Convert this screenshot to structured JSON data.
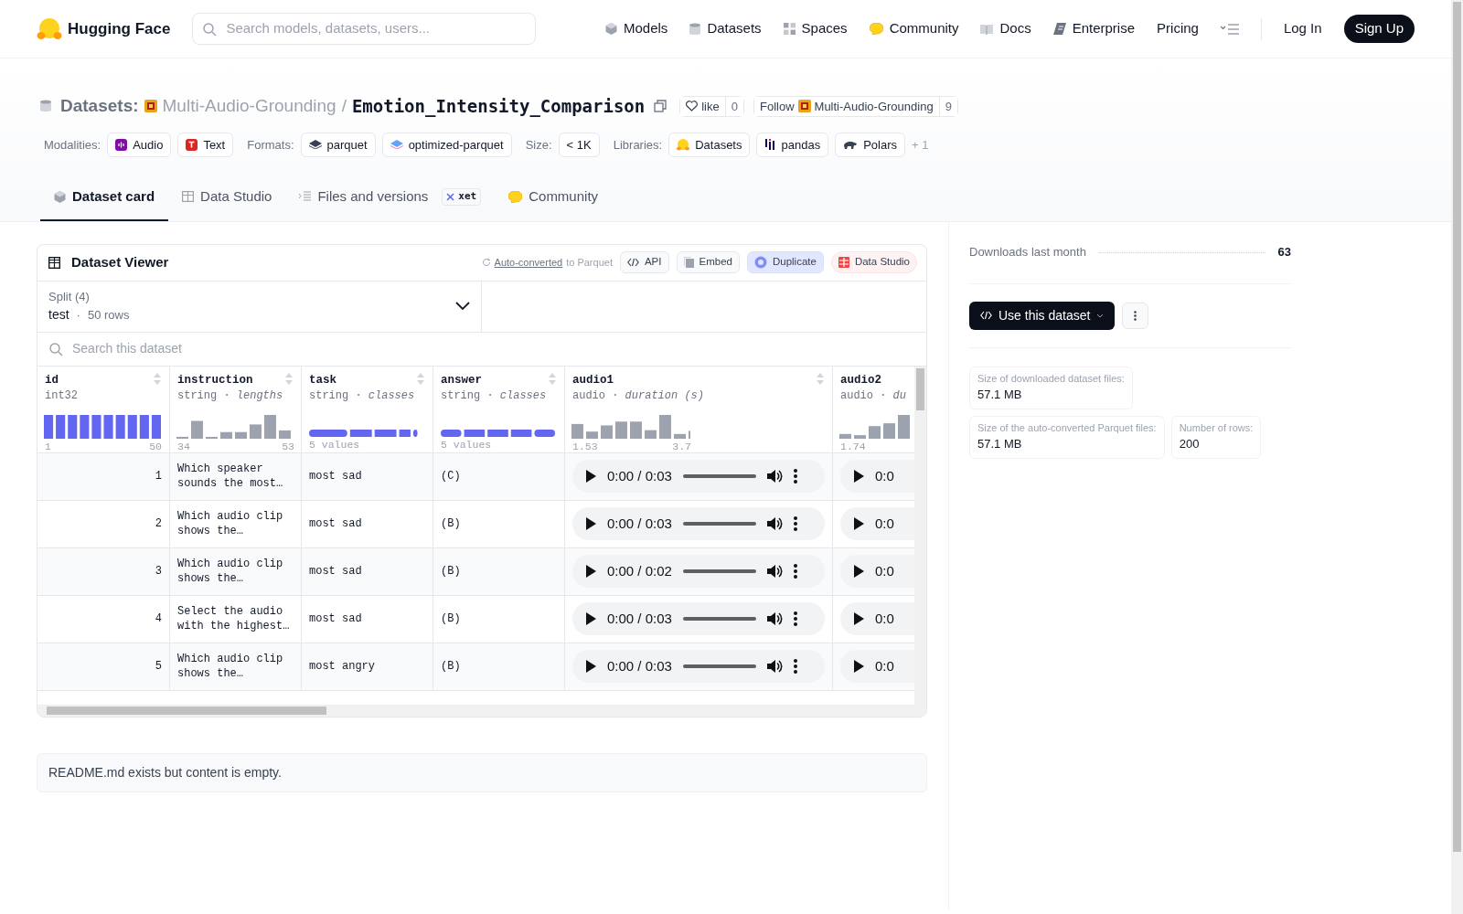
{
  "header": {
    "brand": "Hugging Face",
    "search": {
      "placeholder": "Search models, datasets, users..."
    },
    "nav": [
      {
        "label": "Models"
      },
      {
        "label": "Datasets"
      },
      {
        "label": "Spaces"
      },
      {
        "label": "Community"
      },
      {
        "label": "Docs"
      },
      {
        "label": "Enterprise"
      },
      {
        "label": "Pricing"
      }
    ],
    "login": "Log In",
    "signup": "Sign Up"
  },
  "title": {
    "section": "Datasets:",
    "owner": "Multi-Audio-Grounding",
    "separator": "/",
    "name": "Emotion_Intensity_Comparison",
    "like": "like",
    "like_count": "0",
    "follow": "Follow",
    "follow_org": "Multi-Audio-Grounding",
    "follow_count": "9"
  },
  "tag_groups": [
    {
      "label": "Modalities:",
      "items": [
        "Audio",
        "Text"
      ]
    },
    {
      "label": "Formats:",
      "items": [
        "parquet",
        "optimized-parquet"
      ]
    },
    {
      "label": "Size:",
      "items": [
        "< 1K"
      ]
    },
    {
      "label": "Libraries:",
      "items": [
        "Datasets",
        "pandas",
        "Polars"
      ],
      "more": "+ 1"
    }
  ],
  "tabs": [
    {
      "label": "Dataset card",
      "selected": true
    },
    {
      "label": "Data Studio",
      "selected": false
    },
    {
      "label": "Files and versions",
      "badge": "xet",
      "selected": false
    },
    {
      "label": "Community",
      "selected": false
    }
  ],
  "viewer": {
    "title": "Dataset Viewer",
    "converted_link": "Auto-converted",
    "converted_text": "to Parquet",
    "actions": [
      "API",
      "Embed",
      "Duplicate",
      "Data Studio"
    ],
    "split": {
      "label": "Split (4)",
      "value": "test",
      "separator": "·",
      "rows": "50 rows"
    },
    "search": {
      "placeholder": "Search this dataset"
    },
    "columns": [
      {
        "name": "id",
        "type": "int32",
        "kind": "histogram",
        "min": "1",
        "max": "50"
      },
      {
        "name": "instruction",
        "type": "string · *lengths*",
        "kind": "histogram",
        "min": "34",
        "max": "53"
      },
      {
        "name": "task",
        "type": "string · *classes*",
        "kind": "classes",
        "summary": "5 values"
      },
      {
        "name": "answer",
        "type": "string · *classes*",
        "kind": "classes",
        "summary": "5 values"
      },
      {
        "name": "audio1",
        "type": "audio · *duration (s)*",
        "kind": "histogram",
        "min": "1.53",
        "max": "3.7"
      },
      {
        "name": "audio2",
        "type": "audio · *du*",
        "kind": "histogram",
        "min": "1.74"
      }
    ],
    "rows": [
      {
        "id": "1",
        "instruction": "Which speaker sounds the most…",
        "task": "most sad",
        "answer": "(C)",
        "audio1": "0:00 / 0:03",
        "audio2": "0:0"
      },
      {
        "id": "2",
        "instruction": "Which audio clip shows the…",
        "task": "most sad",
        "answer": "(B)",
        "audio1": "0:00 / 0:03",
        "audio2": "0:0"
      },
      {
        "id": "3",
        "instruction": "Which audio clip shows the…",
        "task": "most sad",
        "answer": "(B)",
        "audio1": "0:00 / 0:02",
        "audio2": "0:0"
      },
      {
        "id": "4",
        "instruction": "Select the audio with the highest…",
        "task": "most sad",
        "answer": "(B)",
        "audio1": "0:00 / 0:03",
        "audio2": "0:0"
      },
      {
        "id": "5",
        "instruction": "Which audio clip shows the…",
        "task": "most angry",
        "answer": "(B)",
        "audio1": "0:00 / 0:03",
        "audio2": "0:0"
      }
    ]
  },
  "readme": "README.md exists but content is empty.",
  "sidebar": {
    "downloads_label": "Downloads last month",
    "downloads": "63",
    "use_button": "Use this dataset",
    "stats": [
      {
        "label": "Size of downloaded dataset files:",
        "value": "57.1 MB"
      },
      {
        "label": "Size of the auto-converted Parquet files:",
        "value": "57.1 MB"
      },
      {
        "label": "Number of rows:",
        "value": "200"
      }
    ]
  }
}
